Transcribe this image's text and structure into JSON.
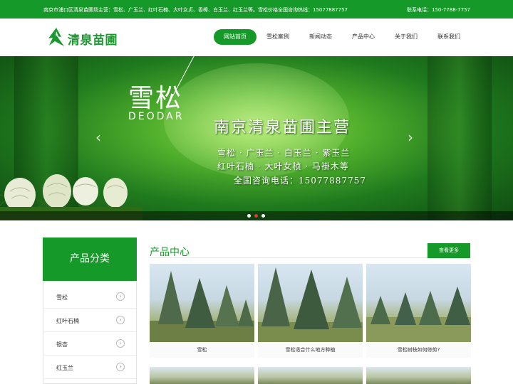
{
  "topbar": {
    "notice": "南京市浦口区清泉苗圃场主营：雪松、广玉兰、红叶石楠、大叶女贞、香樟、白玉兰、红玉兰等。雪松价格全国咨询热线：15077887757",
    "phone": "联系电话：150-7788-7757"
  },
  "logo": {
    "name": "清泉苗圃"
  },
  "nav": [
    {
      "label": "网站首页",
      "active": true
    },
    {
      "label": "雪松案例"
    },
    {
      "label": "新闻动态"
    },
    {
      "label": "产品中心"
    },
    {
      "label": "关于我们"
    },
    {
      "label": "联系我们"
    }
  ],
  "banner": {
    "title": "雪松",
    "subtitle": "DEODAR",
    "headline": "南京清泉苗圃主营",
    "line1": "雪松 · 广玉兰 · 白玉兰 · 紫玉兰",
    "line2": "红叶石楠 · 大叶女桢 · 马褂木等",
    "line3": "全国咨询电话：15077887757",
    "prev": "‹",
    "next": "›",
    "active_slide": 2,
    "slide_count": 3
  },
  "sidebar": {
    "title": "产品分类",
    "items": [
      {
        "label": "雪松"
      },
      {
        "label": "红叶石楠"
      },
      {
        "label": "银杏"
      },
      {
        "label": "红玉兰"
      }
    ],
    "chevron": "›"
  },
  "products": {
    "title": "产品中心",
    "more": "查看更多",
    "items": [
      {
        "caption": "雪松"
      },
      {
        "caption": "雪松适合什么地方种植"
      },
      {
        "caption": "雪松树枝如何修剪?"
      }
    ]
  },
  "colors": {
    "brand_green": "#159a2a",
    "active_dot": "#ee3333"
  },
  "icons": {
    "logo": "leaf-logo-icon",
    "prev": "chevron-left-icon",
    "next": "chevron-right-icon",
    "item": "chevron-right-circle-icon"
  }
}
